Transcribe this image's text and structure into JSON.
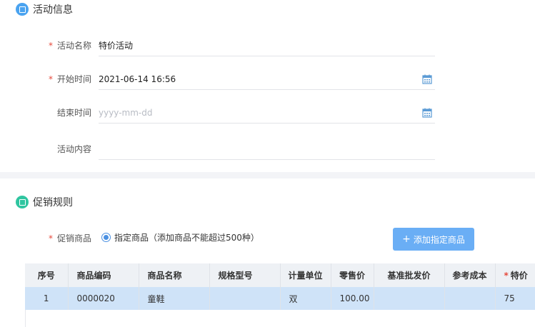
{
  "activity_section": {
    "title": "活动信息",
    "fields": [
      {
        "label": "活动名称",
        "required": true,
        "value": "特价活动",
        "placeholder": ""
      },
      {
        "label": "开始时间",
        "required": true,
        "value": "2021-06-14 16:56",
        "placeholder": ""
      },
      {
        "label": "结束时间",
        "required": false,
        "value": "",
        "placeholder": "yyyy-mm-dd"
      },
      {
        "label": "活动内容",
        "required": false,
        "value": "",
        "placeholder": ""
      }
    ]
  },
  "promo_section": {
    "title": "促销规则",
    "goods_label": "促销商品",
    "radio_option": "指定商品",
    "radio_hint": "（添加商品不能超过500种）",
    "add_button": "添加指定商品"
  },
  "goods_table": {
    "columns": [
      "序号",
      "商品编码",
      "商品名称",
      "规格型号",
      "计量单位",
      "零售价",
      "基准批发价",
      "参考成本",
      "特价"
    ],
    "required_columns": [
      "特价"
    ],
    "rows": [
      [
        "1",
        "0000020",
        "童鞋",
        "",
        "双",
        "100.00",
        "",
        "",
        "75"
      ]
    ]
  },
  "colors": {
    "accent": "#4aa3f0",
    "promo_icon": "#2fc5a0",
    "button": "#6aaef5",
    "required": "#e64a3c",
    "selected_row": "#cfe3f8"
  }
}
